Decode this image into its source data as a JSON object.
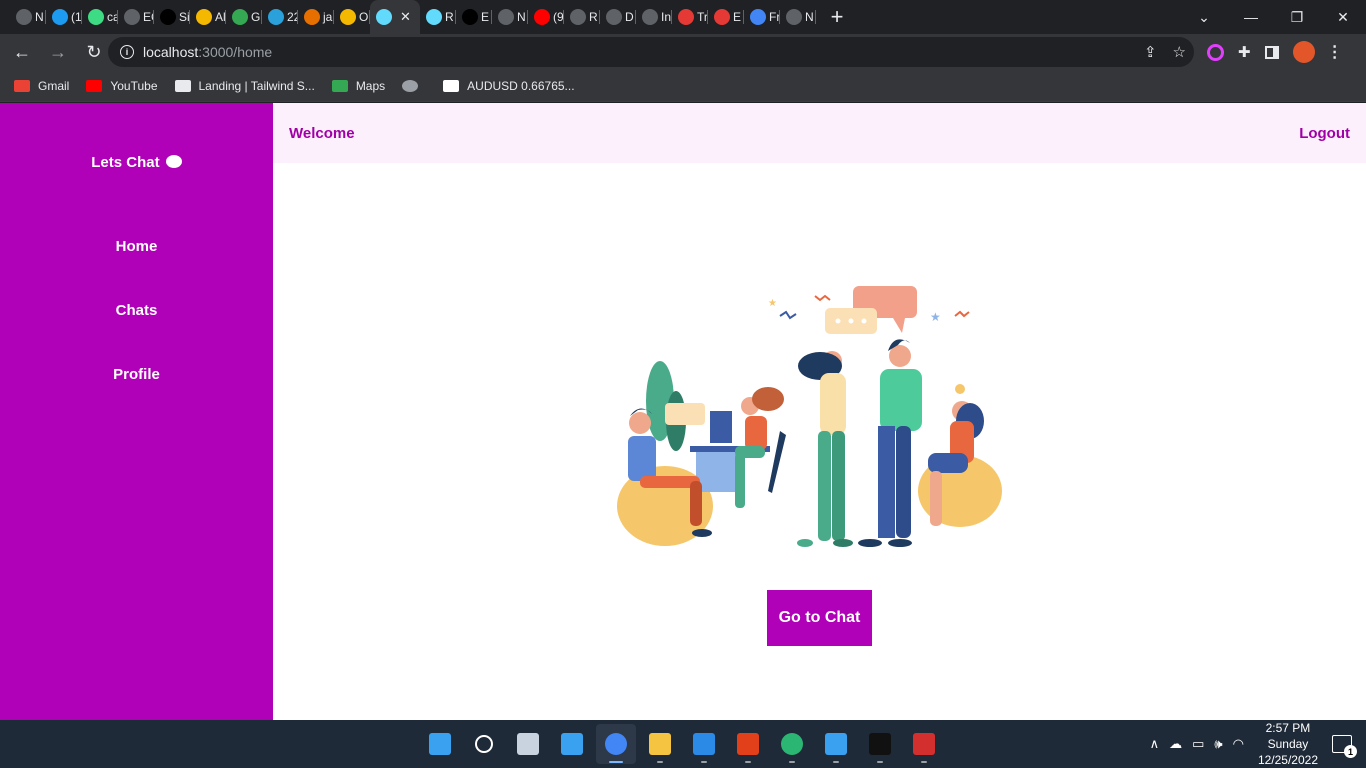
{
  "browser": {
    "tabs": [
      {
        "title": "N",
        "icon": "chrome-icon",
        "color": "#5f6368"
      },
      {
        "title": "(1",
        "icon": "twitter-icon",
        "color": "#1d9bf0"
      },
      {
        "title": "ca",
        "icon": "asterisk-icon",
        "color": "#3ddc84"
      },
      {
        "title": "EC",
        "icon": "github-icon",
        "color": "#5f6368"
      },
      {
        "title": "Si",
        "icon": "triangle-icon",
        "color": "#000000"
      },
      {
        "title": "Al",
        "icon": "flame-icon",
        "color": "#f5b800"
      },
      {
        "title": "G",
        "icon": "meet-icon",
        "color": "#34a853"
      },
      {
        "title": "22",
        "icon": "telegram-icon",
        "color": "#2aa1da"
      },
      {
        "title": "ja",
        "icon": "java-icon",
        "color": "#e76f00"
      },
      {
        "title": "O",
        "icon": "flame-icon",
        "color": "#f5b800"
      },
      {
        "title": "",
        "icon": "react-icon",
        "color": "#61dafb",
        "active": true
      },
      {
        "title": "R",
        "icon": "react-icon",
        "color": "#61dafb"
      },
      {
        "title": "E",
        "icon": "tradingview-icon",
        "color": "#000000"
      },
      {
        "title": "N",
        "icon": "chrome-icon",
        "color": "#5f6368"
      },
      {
        "title": "(9",
        "icon": "youtube-icon",
        "color": "#ff0000"
      },
      {
        "title": "R",
        "icon": "globe-icon",
        "color": "#5f6368"
      },
      {
        "title": "D",
        "icon": "globe-icon",
        "color": "#5f6368"
      },
      {
        "title": "In",
        "icon": "globe-icon",
        "color": "#5f6368"
      },
      {
        "title": "Tr",
        "icon": "app-icon",
        "color": "#e53935"
      },
      {
        "title": "E",
        "icon": "arrow-icon",
        "color": "#e53935"
      },
      {
        "title": "Fr",
        "icon": "robot-icon",
        "color": "#4285f4"
      },
      {
        "title": "N",
        "icon": "chrome-icon",
        "color": "#5f6368"
      }
    ],
    "url_host": "localhost",
    "url_path": ":3000/home",
    "bookmarks": [
      {
        "label": "Gmail",
        "icon": "gmail-icon"
      },
      {
        "label": "YouTube",
        "icon": "youtube-icon"
      },
      {
        "label": "Landing | Tailwind S...",
        "icon": "tailwind-icon"
      },
      {
        "label": "Maps",
        "icon": "maps-icon"
      },
      {
        "label": "",
        "icon": "globe-icon"
      },
      {
        "label": "AUDUSD 0.66765...",
        "icon": "tradingview-icon"
      }
    ]
  },
  "app": {
    "brand": "Lets Chat",
    "brand_icon": "chat-bubble-icon",
    "nav": [
      "Home",
      "Chats",
      "Profile"
    ],
    "header_left": "Welcome",
    "header_right": "Logout",
    "cta": "Go to Chat",
    "accent": "#b000b8",
    "header_bg": "#fdf0fd"
  },
  "taskbar": {
    "apps": [
      "windows-start-icon",
      "search-icon",
      "task-view-icon",
      "widgets-icon",
      "chrome-icon",
      "file-explorer-icon",
      "vscode-icon",
      "office-icon",
      "edge-icon",
      "store-icon",
      "tradingview-icon",
      "acrobat-icon"
    ],
    "time": "2:57 PM",
    "day": "Sunday",
    "date": "12/25/2022",
    "notification_count": "1"
  }
}
